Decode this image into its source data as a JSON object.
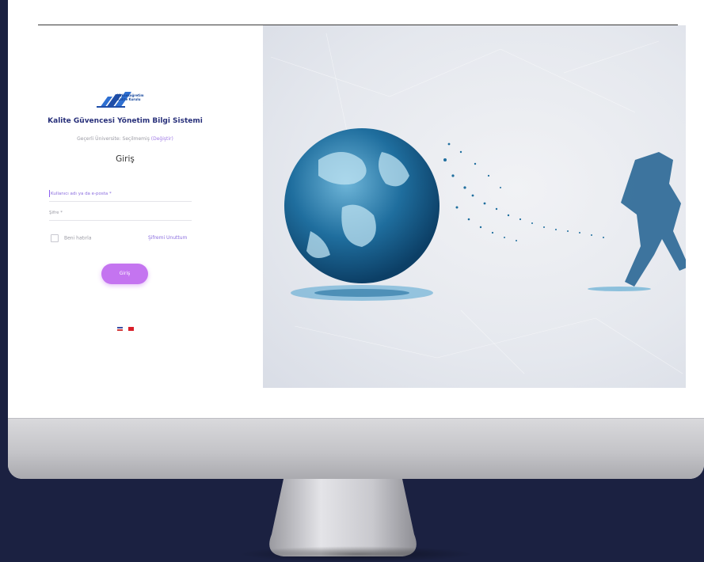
{
  "app": {
    "title": "Kalite Güvencesi Yönetim Bilgi Sistemi",
    "logo_text": [
      "Yükseköğretim",
      "Kalite Kurulu"
    ]
  },
  "login": {
    "university_prefix": "Geçerli Üniversite: Seçilmemiş",
    "university_change": "(Değiştir)",
    "heading": "Giriş",
    "username_placeholder": "Kullanıcı adı ya da e-posta *",
    "password_placeholder": "Şifre *",
    "remember_label": "Beni hatırla",
    "forgot_label": "Şifremi Unuttum",
    "submit_label": "Giriş"
  },
  "languages": [
    "English",
    "Türkçe"
  ],
  "colors": {
    "accent": "#c474f0",
    "link": "#8b6ddf",
    "title": "#28307a",
    "background": "#1b2141"
  },
  "icons": {
    "logo": "yokak-logo-icon",
    "en_flag": "uk-flag-icon",
    "tr_flag": "turkey-flag-icon"
  }
}
